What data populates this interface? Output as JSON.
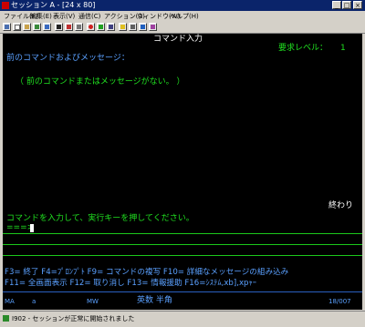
{
  "window": {
    "title": "セッション A - [24 x 80]",
    "min_glyph": "_",
    "max_glyph": "□",
    "close_glyph": "×"
  },
  "menu": [
    "ファイル(F)",
    "編集(E)",
    "表示(V)",
    "通信(C)",
    "アクション(A)",
    "ウィンドウ(W)",
    "ヘルプ(H)"
  ],
  "toolbar_icons": [
    "print-screen-icon",
    "copy-icon",
    "paste-icon",
    "send-icon",
    "receive-icon",
    "display-icon",
    "color-icon",
    "keyboard-icon",
    "macro-record-icon",
    "macro-play-icon",
    "properties-icon",
    "help-icon",
    "settings-icon",
    "session-icon",
    "edit-icon"
  ],
  "screen": {
    "title": "コマンド入力",
    "request_level_label": "要求レベル：",
    "request_level_value": "1",
    "previous_heading": "前のコマンドおよびメッセージ：",
    "previous_message": "（ 前のコマンドまたはメッセージがない。 ）",
    "end_label": "終わり",
    "instruction": "コマンドを入力して、実行キーを押してください。",
    "prompt": "===>",
    "fkeys_line1": "F3= 終了   F4=ﾌﾟﾛﾝﾌﾟﾄ   F9= コマンドの複写   F10= 詳細なメッセージの組み込み",
    "fkeys_line2": "F11= 全画面表示     F12= 取り消し   F13= 情報援助   F16=ｼｽﾃﾑ,xb],xpｬｰ"
  },
  "oia": {
    "ma": "MA",
    "a": "a",
    "mw": "MW",
    "input_mode": "英数 半角",
    "cursor_pos": "18/007"
  },
  "status": {
    "message": "I902 - セッションが正常に開始されました"
  }
}
